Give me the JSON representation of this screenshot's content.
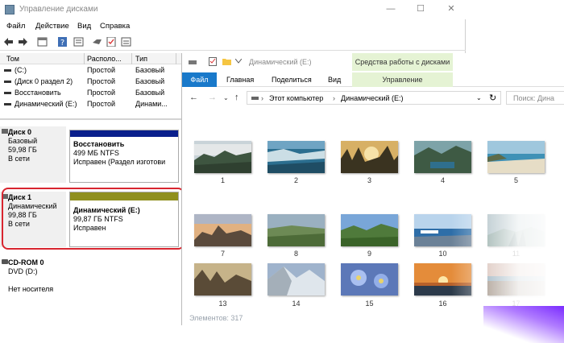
{
  "disk_mgmt": {
    "title": "Управление дисками",
    "menu": [
      "Файл",
      "Действие",
      "Вид",
      "Справка"
    ],
    "window_buttons": [
      "—",
      "☐",
      "✕"
    ],
    "table": {
      "headers": [
        "Том",
        "Располо...",
        "Тип"
      ],
      "rows": [
        [
          "(C:)",
          "Простой",
          "Базовый"
        ],
        [
          "(Диск 0 раздел 2)",
          "Простой",
          "Базовый"
        ],
        [
          "Восстановить",
          "Простой",
          "Базовый"
        ],
        [
          "Динамический (E:)",
          "Простой",
          "Динами..."
        ]
      ]
    },
    "disks": [
      {
        "name": "Диск 0",
        "type": "Базовый",
        "size": "59,98 ГБ",
        "status": "В сети",
        "partition": {
          "name": "Восстановить",
          "size": "499 МБ NTFS",
          "health": "Исправен (Раздел изготови"
        }
      },
      {
        "name": "Диск 1",
        "type": "Динамический",
        "size": "99,88 ГБ",
        "status": "В сети",
        "partition": {
          "name": "Динамический  (E:)",
          "size": "99,87 ГБ NTFS",
          "health": "Исправен"
        }
      },
      {
        "name": "CD-ROM 0",
        "type": "DVD (D:)",
        "size": "",
        "status": "Нет носителя"
      }
    ],
    "colors": {
      "basic_bar": "#0a1f8c",
      "dynamic_bar": "#8f8f1e",
      "callout": "#d8252f"
    }
  },
  "explorer": {
    "title": "Динамический (E:)",
    "context_tab": "Средства работы с дисками",
    "ribbon_tabs": [
      "Файл",
      "Главная",
      "Поделиться",
      "Вид"
    ],
    "context_subtab": "Управление",
    "nav": {
      "back": "←",
      "forward": "→",
      "up": "↑",
      "down": "⌄",
      "refresh": "↻"
    },
    "breadcrumb": [
      "Этот компьютер",
      "Динамический (E:)"
    ],
    "search_placeholder": "Поиск: Дина",
    "thumbnails": [
      "1",
      "2",
      "3",
      "4",
      "5",
      "7",
      "8",
      "9",
      "10",
      "11",
      "13",
      "14",
      "15",
      "16",
      "17"
    ],
    "status": "Элементов: 317"
  }
}
